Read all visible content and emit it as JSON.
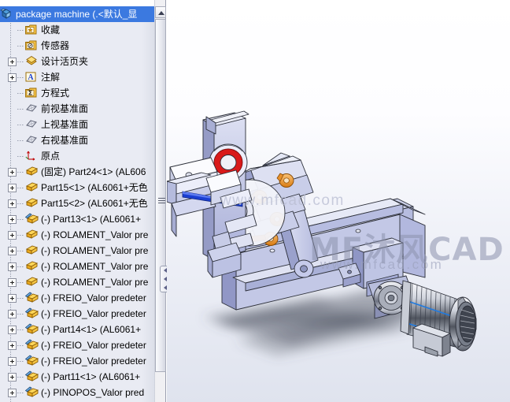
{
  "window": {
    "title": "SolidWorks assembly feature tree"
  },
  "tree": {
    "root": {
      "label": "package machine  (.<默认_显",
      "icon": "assembly-icon",
      "selected": true
    },
    "items": [
      {
        "label": "收藏",
        "icon": "favorites-folder-icon",
        "expandable": false,
        "indent": 1
      },
      {
        "label": "传感器",
        "icon": "sensors-folder-icon",
        "expandable": false,
        "indent": 1
      },
      {
        "label": "设计活页夹",
        "icon": "design-binder-icon",
        "expandable": true,
        "indent": 1
      },
      {
        "label": "注解",
        "icon": "annotations-icon",
        "expandable": true,
        "indent": 1
      },
      {
        "label": "方程式",
        "icon": "equations-icon",
        "expandable": false,
        "indent": 1
      },
      {
        "label": "前视基准面",
        "icon": "plane-icon",
        "expandable": false,
        "indent": 1
      },
      {
        "label": "上视基准面",
        "icon": "plane-icon",
        "expandable": false,
        "indent": 1
      },
      {
        "label": "右视基准面",
        "icon": "plane-icon",
        "expandable": false,
        "indent": 1
      },
      {
        "label": "原点",
        "icon": "origin-icon",
        "expandable": false,
        "indent": 1
      },
      {
        "label": "(固定) Part24<1>  (AL606",
        "icon": "part-icon",
        "expandable": true,
        "indent": 1
      },
      {
        "label": "Part15<1>  (AL6061+无色",
        "icon": "part-icon",
        "expandable": true,
        "indent": 1
      },
      {
        "label": "Part15<2>  (AL6061+无色",
        "icon": "part-icon",
        "expandable": true,
        "indent": 1
      },
      {
        "label": "(-) Part13<1>  (AL6061+",
        "icon": "part-flex-icon",
        "expandable": true,
        "indent": 1
      },
      {
        "label": "(-) ROLAMENT_Valor pre",
        "icon": "part-icon",
        "expandable": true,
        "indent": 1
      },
      {
        "label": "(-) ROLAMENT_Valor pre",
        "icon": "part-icon",
        "expandable": true,
        "indent": 1
      },
      {
        "label": "(-) ROLAMENT_Valor pre",
        "icon": "part-icon",
        "expandable": true,
        "indent": 1
      },
      {
        "label": "(-) ROLAMENT_Valor pre",
        "icon": "part-icon",
        "expandable": true,
        "indent": 1
      },
      {
        "label": "(-) FREIO_Valor predeter",
        "icon": "part-flex-icon",
        "expandable": true,
        "indent": 1
      },
      {
        "label": "(-) FREIO_Valor predeter",
        "icon": "part-flex-icon",
        "expandable": true,
        "indent": 1
      },
      {
        "label": "(-) Part14<1>  (AL6061+",
        "icon": "part-flex-icon",
        "expandable": true,
        "indent": 1
      },
      {
        "label": "(-) FREIO_Valor predeter",
        "icon": "part-flex-icon",
        "expandable": true,
        "indent": 1
      },
      {
        "label": "(-) FREIO_Valor predeter",
        "icon": "part-flex-icon",
        "expandable": true,
        "indent": 1
      },
      {
        "label": "(-) Part11<1>  (AL6061+",
        "icon": "part-flex-icon",
        "expandable": true,
        "indent": 1
      },
      {
        "label": "(-) PINOPOS_Valor pred",
        "icon": "part-flex-icon",
        "expandable": true,
        "indent": 1
      }
    ]
  },
  "scrollbar": {
    "up_arrow": "scroll-up-arrow",
    "grip": "splitter-grip",
    "panel_handle": "panel-collapse-handle"
  },
  "viewport": {
    "model_name": "package machine",
    "watermark_main": "MF沐风CAD",
    "watermark_sub": "www.mfcad.com",
    "watermark_center": "www.mfcad.com",
    "colors": {
      "body": "#b9bee0",
      "body_light": "#d4d8ee",
      "body_dark": "#8f95c2",
      "accent_orange": "#e8912c",
      "accent_red": "#d91a1a",
      "accent_blue": "#1a3fd1",
      "metal": "#9aa0ae",
      "outline": "#30333d"
    }
  }
}
